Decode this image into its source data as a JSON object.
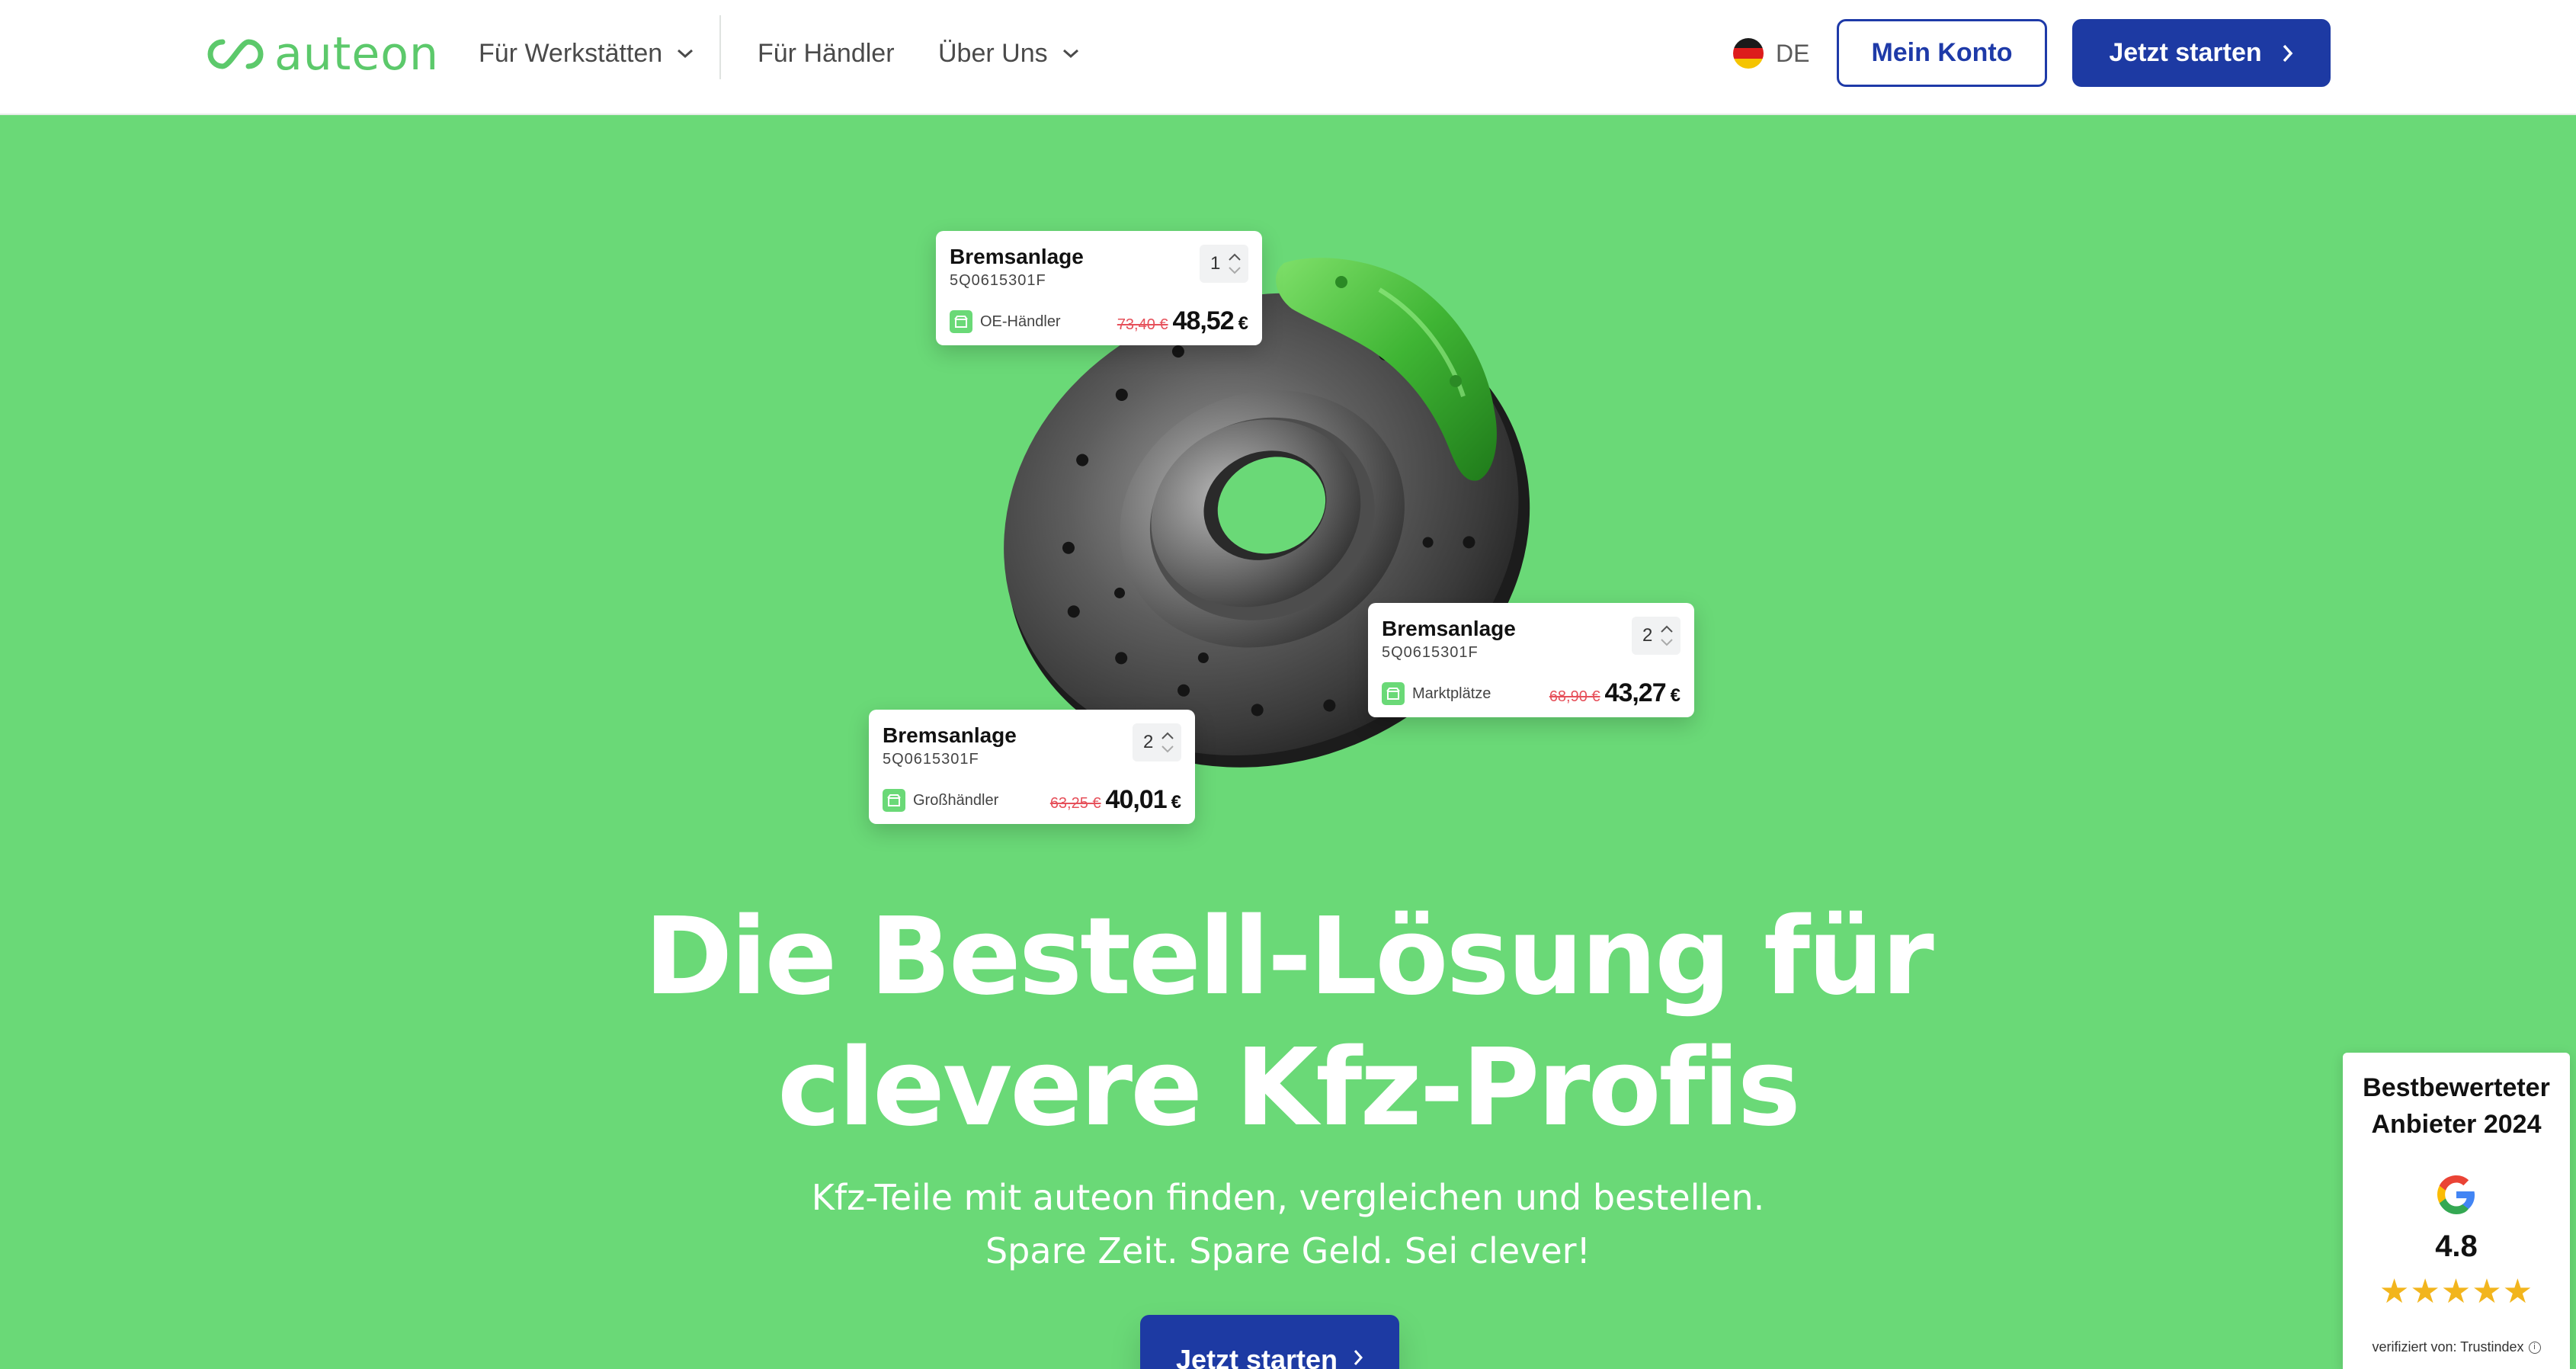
{
  "nav": {
    "logo_text": "auteon",
    "items": [
      {
        "label": "Für Werkstätten",
        "has_dropdown": true
      },
      {
        "label": "Für Händler",
        "has_dropdown": false
      },
      {
        "label": "Über Uns",
        "has_dropdown": true
      }
    ],
    "language": "DE",
    "account_label": "Mein Konto",
    "cta_label": "Jetzt starten"
  },
  "colors": {
    "hero_bg": "#6ad977",
    "brand_green": "#5cc96b",
    "primary_blue": "#1d3aa3",
    "old_price_red": "#e6505a",
    "star_gold": "#f2b51d"
  },
  "cards": [
    {
      "title": "Bremsanlage",
      "sku": "5Q0615301F",
      "qty": "1",
      "source": "OE-Händler",
      "old_price": "73,40 €",
      "new_price": "48,52",
      "currency": "€"
    },
    {
      "title": "Bremsanlage",
      "sku": "5Q0615301F",
      "qty": "2",
      "source": "Marktplätze",
      "old_price": "68,90 €",
      "new_price": "43,27",
      "currency": "€"
    },
    {
      "title": "Bremsanlage",
      "sku": "5Q0615301F",
      "qty": "2",
      "source": "Großhändler",
      "old_price": "63,25 €",
      "new_price": "40,01",
      "currency": "€"
    }
  ],
  "hero": {
    "headline_line1": "Die Bestell-Lösung für",
    "headline_line2": "clevere Kfz-Profis",
    "subline_line1": "Kfz-Teile mit auteon finden, vergleichen und bestellen.",
    "subline_line2": "Spare Zeit. Spare Geld. Sei clever!",
    "cta_label": "Jetzt starten"
  },
  "trust": {
    "title_line1": "Bestbewerteter",
    "title_line2": "Anbieter 2024",
    "score": "4.8",
    "rating_value": 5,
    "stars": "★★★★★",
    "verified": "verifiziert von: Trustindex",
    "info_glyph": "i"
  }
}
